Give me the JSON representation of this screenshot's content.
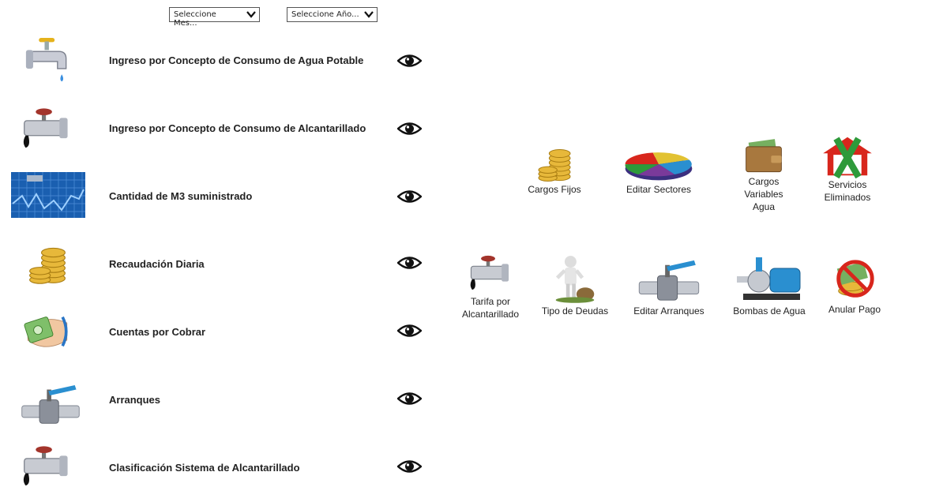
{
  "filters": {
    "month": {
      "selected": "Seleccione Mes..."
    },
    "year": {
      "selected": "Seleccione Año..."
    }
  },
  "reports": [
    {
      "label": "Ingreso por Concepto de Consumo de Agua Potable",
      "icon": "water-faucet-icon"
    },
    {
      "label": "Ingreso por Concepto de Consumo de Alcantarillado",
      "icon": "sewer-pipe-icon"
    },
    {
      "label": "Cantidad de M3 suministrado",
      "icon": "water-chart-icon"
    },
    {
      "label": "Recaudación Diaria",
      "icon": "coins-icon"
    },
    {
      "label": "Cuentas por Cobrar",
      "icon": "money-hand-icon"
    },
    {
      "label": "Arranques",
      "icon": "valve-icon"
    },
    {
      "label": "Clasificación Sistema de Alcantarillado",
      "icon": "sewer-pipe-icon"
    }
  ],
  "view_icon": "eye-icon",
  "tiles": [
    {
      "label": "Cargos Fijos",
      "icon": "coins-icon"
    },
    {
      "label": "Editar Sectores",
      "icon": "pie-chart-icon"
    },
    {
      "label": "Cargos Variables Agua",
      "icon": "wallet-icon"
    },
    {
      "label": "Servicios Eliminados",
      "icon": "house-x-icon"
    },
    {
      "label": "Tarifa por Alcantarillado",
      "icon": "sewer-pipe-icon"
    },
    {
      "label": "Tipo de Deudas",
      "icon": "person-debt-icon"
    },
    {
      "label": "Editar Arranques",
      "icon": "valve-icon"
    },
    {
      "label": "Bombas de Agua",
      "icon": "water-pump-icon"
    },
    {
      "label": "Anular Pago",
      "icon": "cancel-payment-icon"
    }
  ],
  "colors": {
    "accent_blue": "#2a8fd0",
    "red": "#d8261c",
    "green": "#2e9a3a",
    "gold": "#e2b232"
  }
}
